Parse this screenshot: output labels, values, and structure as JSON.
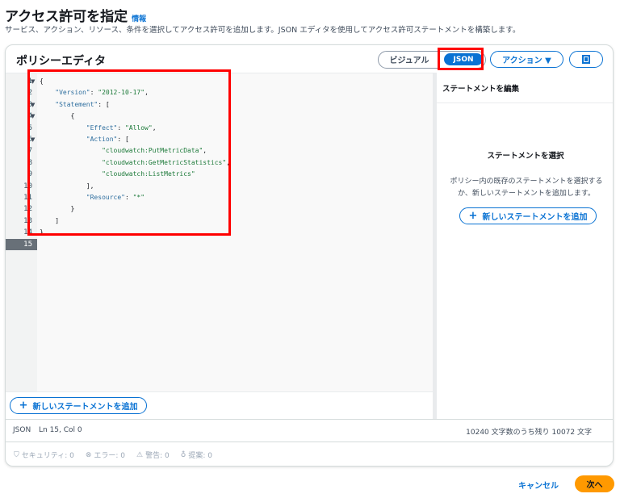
{
  "header": {
    "title": "アクセス許可を指定",
    "info_link": "情報",
    "description": "サービス、アクション、リソース、条件を選択してアクセス許可を追加します。JSON エディタを使用してアクセス許可ステートメントを構築します。"
  },
  "editor_card": {
    "title": "ポリシーエディタ",
    "mode_visual": "ビジュアル",
    "mode_json": "JSON",
    "actions_label": "アクション ▼"
  },
  "code": {
    "line_numbers": [
      "1",
      "2",
      "3",
      "4",
      "5",
      "6",
      "7",
      "8",
      "9",
      "10",
      "11",
      "12",
      "13",
      "14",
      "15"
    ],
    "fold_lines": [
      1,
      3,
      4,
      6
    ],
    "lines": [
      [
        {
          "t": "{",
          "c": ""
        }
      ],
      [
        {
          "t": "    ",
          "c": ""
        },
        {
          "t": "\"Version\"",
          "c": "k"
        },
        {
          "t": ": ",
          "c": ""
        },
        {
          "t": "\"2012-10-17\"",
          "c": "s"
        },
        {
          "t": ",",
          "c": ""
        }
      ],
      [
        {
          "t": "    ",
          "c": ""
        },
        {
          "t": "\"Statement\"",
          "c": "k"
        },
        {
          "t": ": [",
          "c": ""
        }
      ],
      [
        {
          "t": "        {",
          "c": ""
        }
      ],
      [
        {
          "t": "            ",
          "c": ""
        },
        {
          "t": "\"Effect\"",
          "c": "k"
        },
        {
          "t": ": ",
          "c": ""
        },
        {
          "t": "\"Allow\"",
          "c": "s"
        },
        {
          "t": ",",
          "c": ""
        }
      ],
      [
        {
          "t": "            ",
          "c": ""
        },
        {
          "t": "\"Action\"",
          "c": "k"
        },
        {
          "t": ": [",
          "c": ""
        }
      ],
      [
        {
          "t": "                ",
          "c": ""
        },
        {
          "t": "\"cloudwatch:PutMetricData\"",
          "c": "s"
        },
        {
          "t": ",",
          "c": ""
        }
      ],
      [
        {
          "t": "                ",
          "c": ""
        },
        {
          "t": "\"cloudwatch:GetMetricStatistics\"",
          "c": "s"
        },
        {
          "t": ",",
          "c": ""
        }
      ],
      [
        {
          "t": "                ",
          "c": ""
        },
        {
          "t": "\"cloudwatch:ListMetrics\"",
          "c": "s"
        }
      ],
      [
        {
          "t": "            ],",
          "c": ""
        }
      ],
      [
        {
          "t": "            ",
          "c": ""
        },
        {
          "t": "\"Resource\"",
          "c": "k"
        },
        {
          "t": ": ",
          "c": ""
        },
        {
          "t": "\"*\"",
          "c": "s"
        }
      ],
      [
        {
          "t": "        }",
          "c": ""
        }
      ],
      [
        {
          "t": "    ]",
          "c": ""
        }
      ],
      [
        {
          "t": "}",
          "c": ""
        }
      ],
      []
    ],
    "active_line": 15
  },
  "add_statement_label": "新しいステートメントを追加",
  "right_panel": {
    "title": "ステートメントを編集",
    "empty_title": "ステートメントを選択",
    "empty_text": "ポリシー内の既存のステートメントを選択するか、新しいステートメントを追加します。",
    "add_label": "新しいステートメントを追加"
  },
  "status": {
    "language": "JSON",
    "position": "Ln 15, Col 0",
    "char_count": "10240 文字数のうち残り 10072 文字"
  },
  "issues": {
    "security": "セキュリティ: 0",
    "errors": "エラー: 0",
    "warnings": "警告: 0",
    "suggestions": "提案: 0"
  },
  "footer": {
    "cancel": "キャンセル",
    "next": "次へ"
  },
  "colors": {
    "accent": "#0972d3",
    "primary_button": "#ff9900",
    "annotation": "#ff0000"
  }
}
